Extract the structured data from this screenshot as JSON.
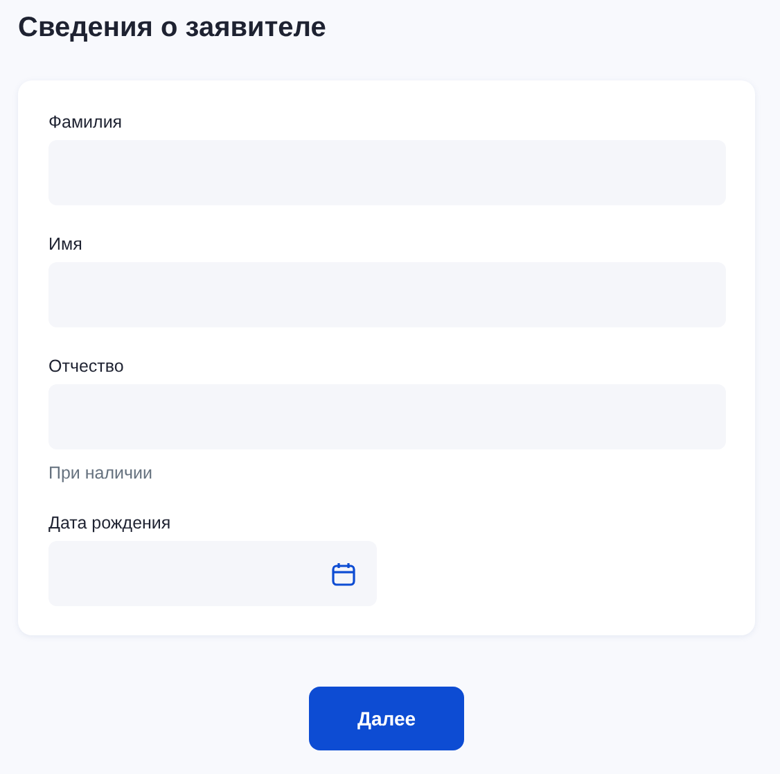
{
  "title": "Сведения о заявителе",
  "fields": [
    {
      "kind": "text",
      "label": "Фамилия"
    },
    {
      "kind": "text",
      "label": "Имя"
    },
    {
      "kind": "text",
      "label": "Отчество",
      "hint": "При наличии"
    },
    {
      "kind": "date",
      "label": "Дата рождения"
    }
  ],
  "buttons": [
    "Далее"
  ]
}
